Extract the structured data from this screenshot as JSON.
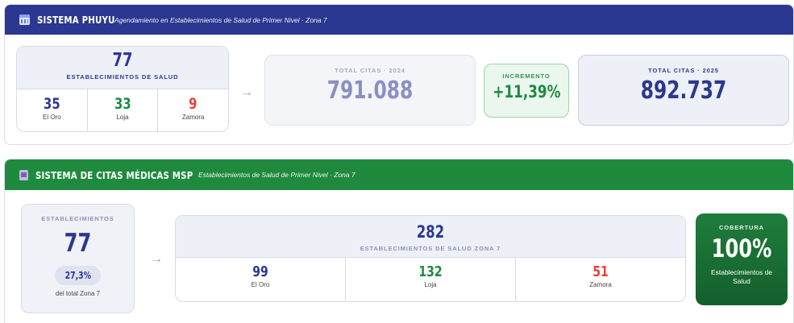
{
  "section1": {
    "title": "SISTEMA PHUYU",
    "subtitle": "Agendamiento en Establecimientos de Salud de Primer Nivel · Zona 7",
    "establishments": {
      "total": "77",
      "label": "ESTABLECIMIENTOS DE SALUD",
      "breakdown": [
        {
          "value": "35",
          "name": "El Oro"
        },
        {
          "value": "33",
          "name": "Loja"
        },
        {
          "value": "9",
          "name": "Zamora"
        }
      ]
    },
    "arrow": "→",
    "total_2024": {
      "label": "TOTAL CITAS · 2024",
      "value": "791.088"
    },
    "increment": {
      "label": "INCREMENTO",
      "value": "+11,39%"
    },
    "total_2025": {
      "label": "TOTAL CITAS · 2025",
      "value": "892.737"
    }
  },
  "section2": {
    "title": "SISTEMA DE CITAS MÉDICAS MSP",
    "subtitle": "Establecimientos de Salud de Primer Nivel · Zona 7",
    "establishments": {
      "label": "ESTABLECIMIENTOS",
      "value": "77",
      "percent": "27,3%",
      "percent_caption": "del total Zona 7"
    },
    "arrow": "→",
    "zone": {
      "total": "282",
      "label": "ESTABLECIMIENTOS DE SALUD ZONA 7",
      "breakdown": [
        {
          "value": "99",
          "name": "El Oro"
        },
        {
          "value": "132",
          "name": "Loja"
        },
        {
          "value": "51",
          "name": "Zamora"
        }
      ]
    },
    "coverage": {
      "label": "COBERTURA",
      "value": "100%",
      "description": "Establecimientos de Salud"
    }
  },
  "colors": {
    "navy": "#2b3891",
    "green": "#1f8a3e",
    "red": "#e0453c"
  }
}
